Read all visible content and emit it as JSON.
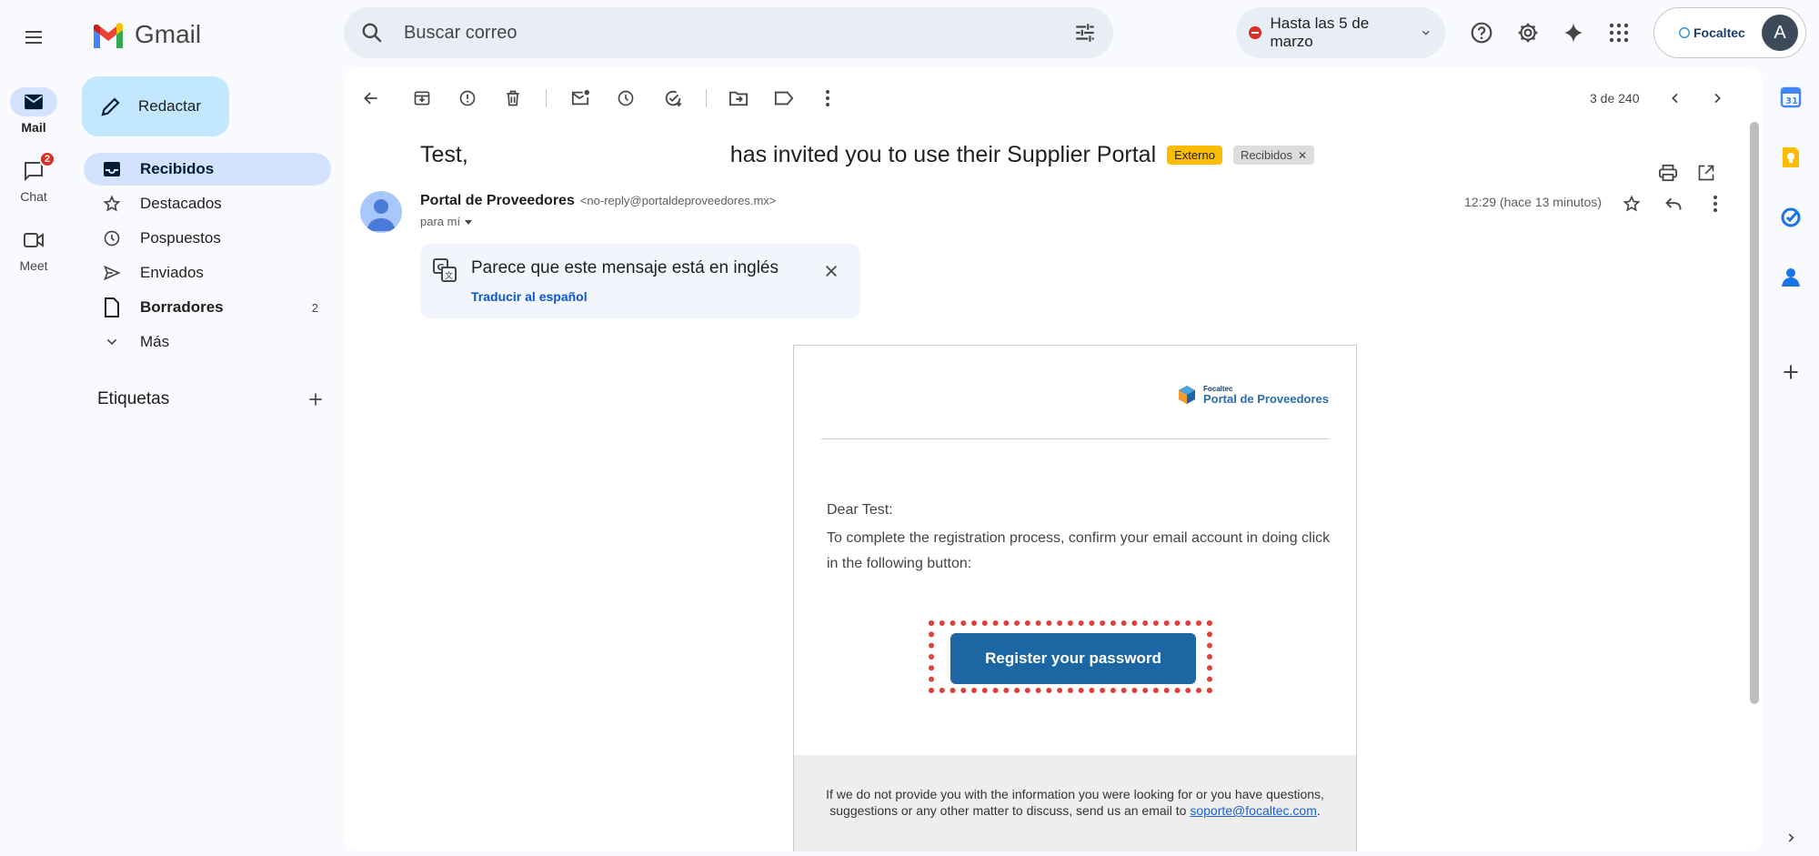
{
  "header": {
    "app_name": "Gmail",
    "search_placeholder": "Buscar correo",
    "status_label": "Hasta las 5 de marzo",
    "org_name": "Focaltec",
    "avatar_letter": "A"
  },
  "rail": {
    "mail": "Mail",
    "chat": "Chat",
    "chat_badge": "2",
    "meet": "Meet"
  },
  "nav": {
    "compose": "Redactar",
    "items": [
      {
        "label": "Recibidos",
        "count": ""
      },
      {
        "label": "Destacados",
        "count": ""
      },
      {
        "label": "Pospuestos",
        "count": ""
      },
      {
        "label": "Enviados",
        "count": ""
      },
      {
        "label": "Borradores",
        "count": "2"
      },
      {
        "label": "Más",
        "count": ""
      }
    ],
    "labels_title": "Etiquetas"
  },
  "toolbar": {
    "pager": "3 de 240"
  },
  "message": {
    "subject_start": "Test,",
    "subject_end": "has invited you to use their Supplier Portal",
    "tag_external": "Externo",
    "tag_inbox": "Recibidos",
    "sender_name": "Portal de Proveedores",
    "sender_email": "<no-reply@portaldeproveedores.mx>",
    "to": "para mí",
    "time": "12:29 (hace 13 minutos)",
    "translate_title": "Parece que este mensaje está en inglés",
    "translate_link": "Traducir al español"
  },
  "email": {
    "brand_small": "Focaltec",
    "brand_big": "Portal de Proveedores",
    "greeting": "Dear Test:",
    "body": "To complete the registration process, confirm your email account in doing click in the following button:",
    "button": "Register your password",
    "footer_text": "If we do not provide you with the information you were looking for or you have questions, suggestions or any other matter to discuss, send us an email to",
    "footer_link": "soporte@focaltec.com",
    "footer_end": "."
  },
  "colors": {
    "accent": "#0b57d0",
    "compose_bg": "#c2e7ff",
    "active_nav": "#d3e3fd",
    "register_button": "#1c67a3",
    "highlight": "#e0403a"
  }
}
